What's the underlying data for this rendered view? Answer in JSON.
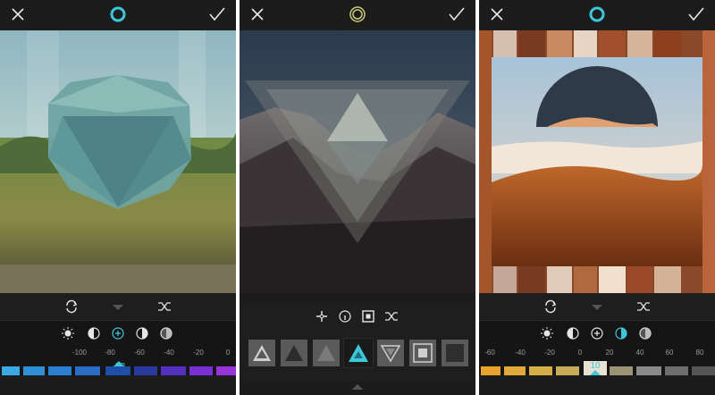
{
  "colors": {
    "accent": "#3ec6da",
    "background": "#1c1c1c",
    "icon": "#e6e6e6"
  },
  "panels": [
    {
      "logo_icon": "ring-icon",
      "slider": {
        "labels": [
          "-100",
          "-80",
          "-60",
          "-40",
          "-20",
          "0"
        ],
        "current_value": "-73"
      }
    },
    {
      "logo_icon": "double-ring-icon",
      "filters": [
        "triangle-outline",
        "triangle-dark",
        "triangle-light",
        "triangle-selected",
        "triangle-inverted",
        "square-nested",
        "square-dark"
      ],
      "selected_filter": 3
    },
    {
      "logo_icon": "ring-icon",
      "slider": {
        "labels": [
          "-60",
          "-40",
          "-20",
          "0",
          "20",
          "40",
          "60",
          "80"
        ],
        "current_value": "10"
      }
    }
  ]
}
